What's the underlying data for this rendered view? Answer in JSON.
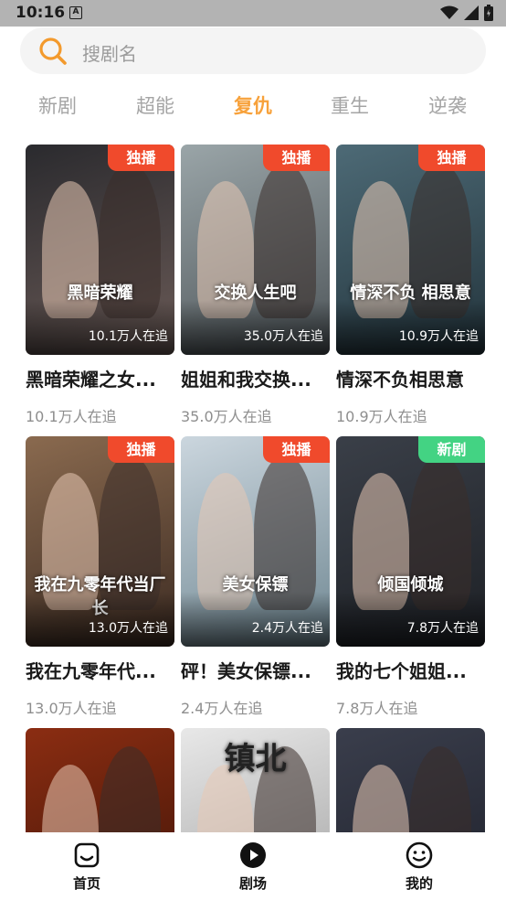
{
  "status_bar": {
    "time": "10:16",
    "notification_letter": "A"
  },
  "search": {
    "placeholder": "搜剧名"
  },
  "tabs": [
    {
      "label": "新剧",
      "active": false
    },
    {
      "label": "超能",
      "active": false
    },
    {
      "label": "复仇",
      "active": true
    },
    {
      "label": "重生",
      "active": false
    },
    {
      "label": "逆袭",
      "active": false
    }
  ],
  "dramas": [
    {
      "title": "黑暗荣耀之女...",
      "badge": "独播",
      "badge_type": "exclusive",
      "poster_count": "10.1万人在追",
      "followers": "10.1万人在追",
      "poster_text": "黑暗荣耀",
      "colors": [
        "#2a2a2e",
        "#6b5b57"
      ]
    },
    {
      "title": "姐姐和我交换...",
      "badge": "独播",
      "badge_type": "exclusive",
      "poster_count": "35.0万人在追",
      "followers": "35.0万人在追",
      "poster_text": "交换人生吧",
      "colors": [
        "#9aa5a8",
        "#4d5458"
      ]
    },
    {
      "title": "情深不负相思意",
      "badge": "独播",
      "badge_type": "exclusive",
      "poster_count": "10.9万人在追",
      "followers": "10.9万人在追",
      "poster_text": "情深不负 相思意",
      "colors": [
        "#4d6a76",
        "#23343c"
      ]
    },
    {
      "title": "我在九零年代...",
      "badge": "独播",
      "badge_type": "exclusive",
      "poster_count": "13.0万人在追",
      "followers": "13.0万人在追",
      "poster_text": "我在九零年代当厂长",
      "colors": [
        "#8a6a4f",
        "#3c2b22"
      ]
    },
    {
      "title": "砰！美女保镖...",
      "badge": "独播",
      "badge_type": "exclusive",
      "poster_count": "2.4万人在追",
      "followers": "2.4万人在追",
      "poster_text": "美女保镖",
      "colors": [
        "#cbd6de",
        "#6f8792"
      ]
    },
    {
      "title": "我的七个姐姐...",
      "badge": "新剧",
      "badge_type": "new",
      "poster_count": "7.8万人在追",
      "followers": "7.8万人在追",
      "poster_text": "倾国倾城",
      "colors": [
        "#3a3f48",
        "#1d2025"
      ]
    },
    {
      "title": "",
      "badge": "",
      "badge_type": "",
      "poster_count": "",
      "followers": "",
      "poster_text": "",
      "colors": [
        "#8b2d12",
        "#3a1206"
      ]
    },
    {
      "title": "",
      "badge": "",
      "badge_type": "",
      "poster_count": "",
      "followers": "",
      "poster_text": "镇北",
      "colors": [
        "#e8e8e8",
        "#9c9c9c"
      ]
    },
    {
      "title": "",
      "badge": "",
      "badge_type": "",
      "poster_count": "",
      "followers": "",
      "poster_text": "",
      "colors": [
        "#3a3e4c",
        "#1c1e28"
      ]
    }
  ],
  "bottom_nav": [
    {
      "label": "首页",
      "icon": "home-icon"
    },
    {
      "label": "剧场",
      "icon": "play-icon"
    },
    {
      "label": "我的",
      "icon": "smile-icon"
    }
  ]
}
